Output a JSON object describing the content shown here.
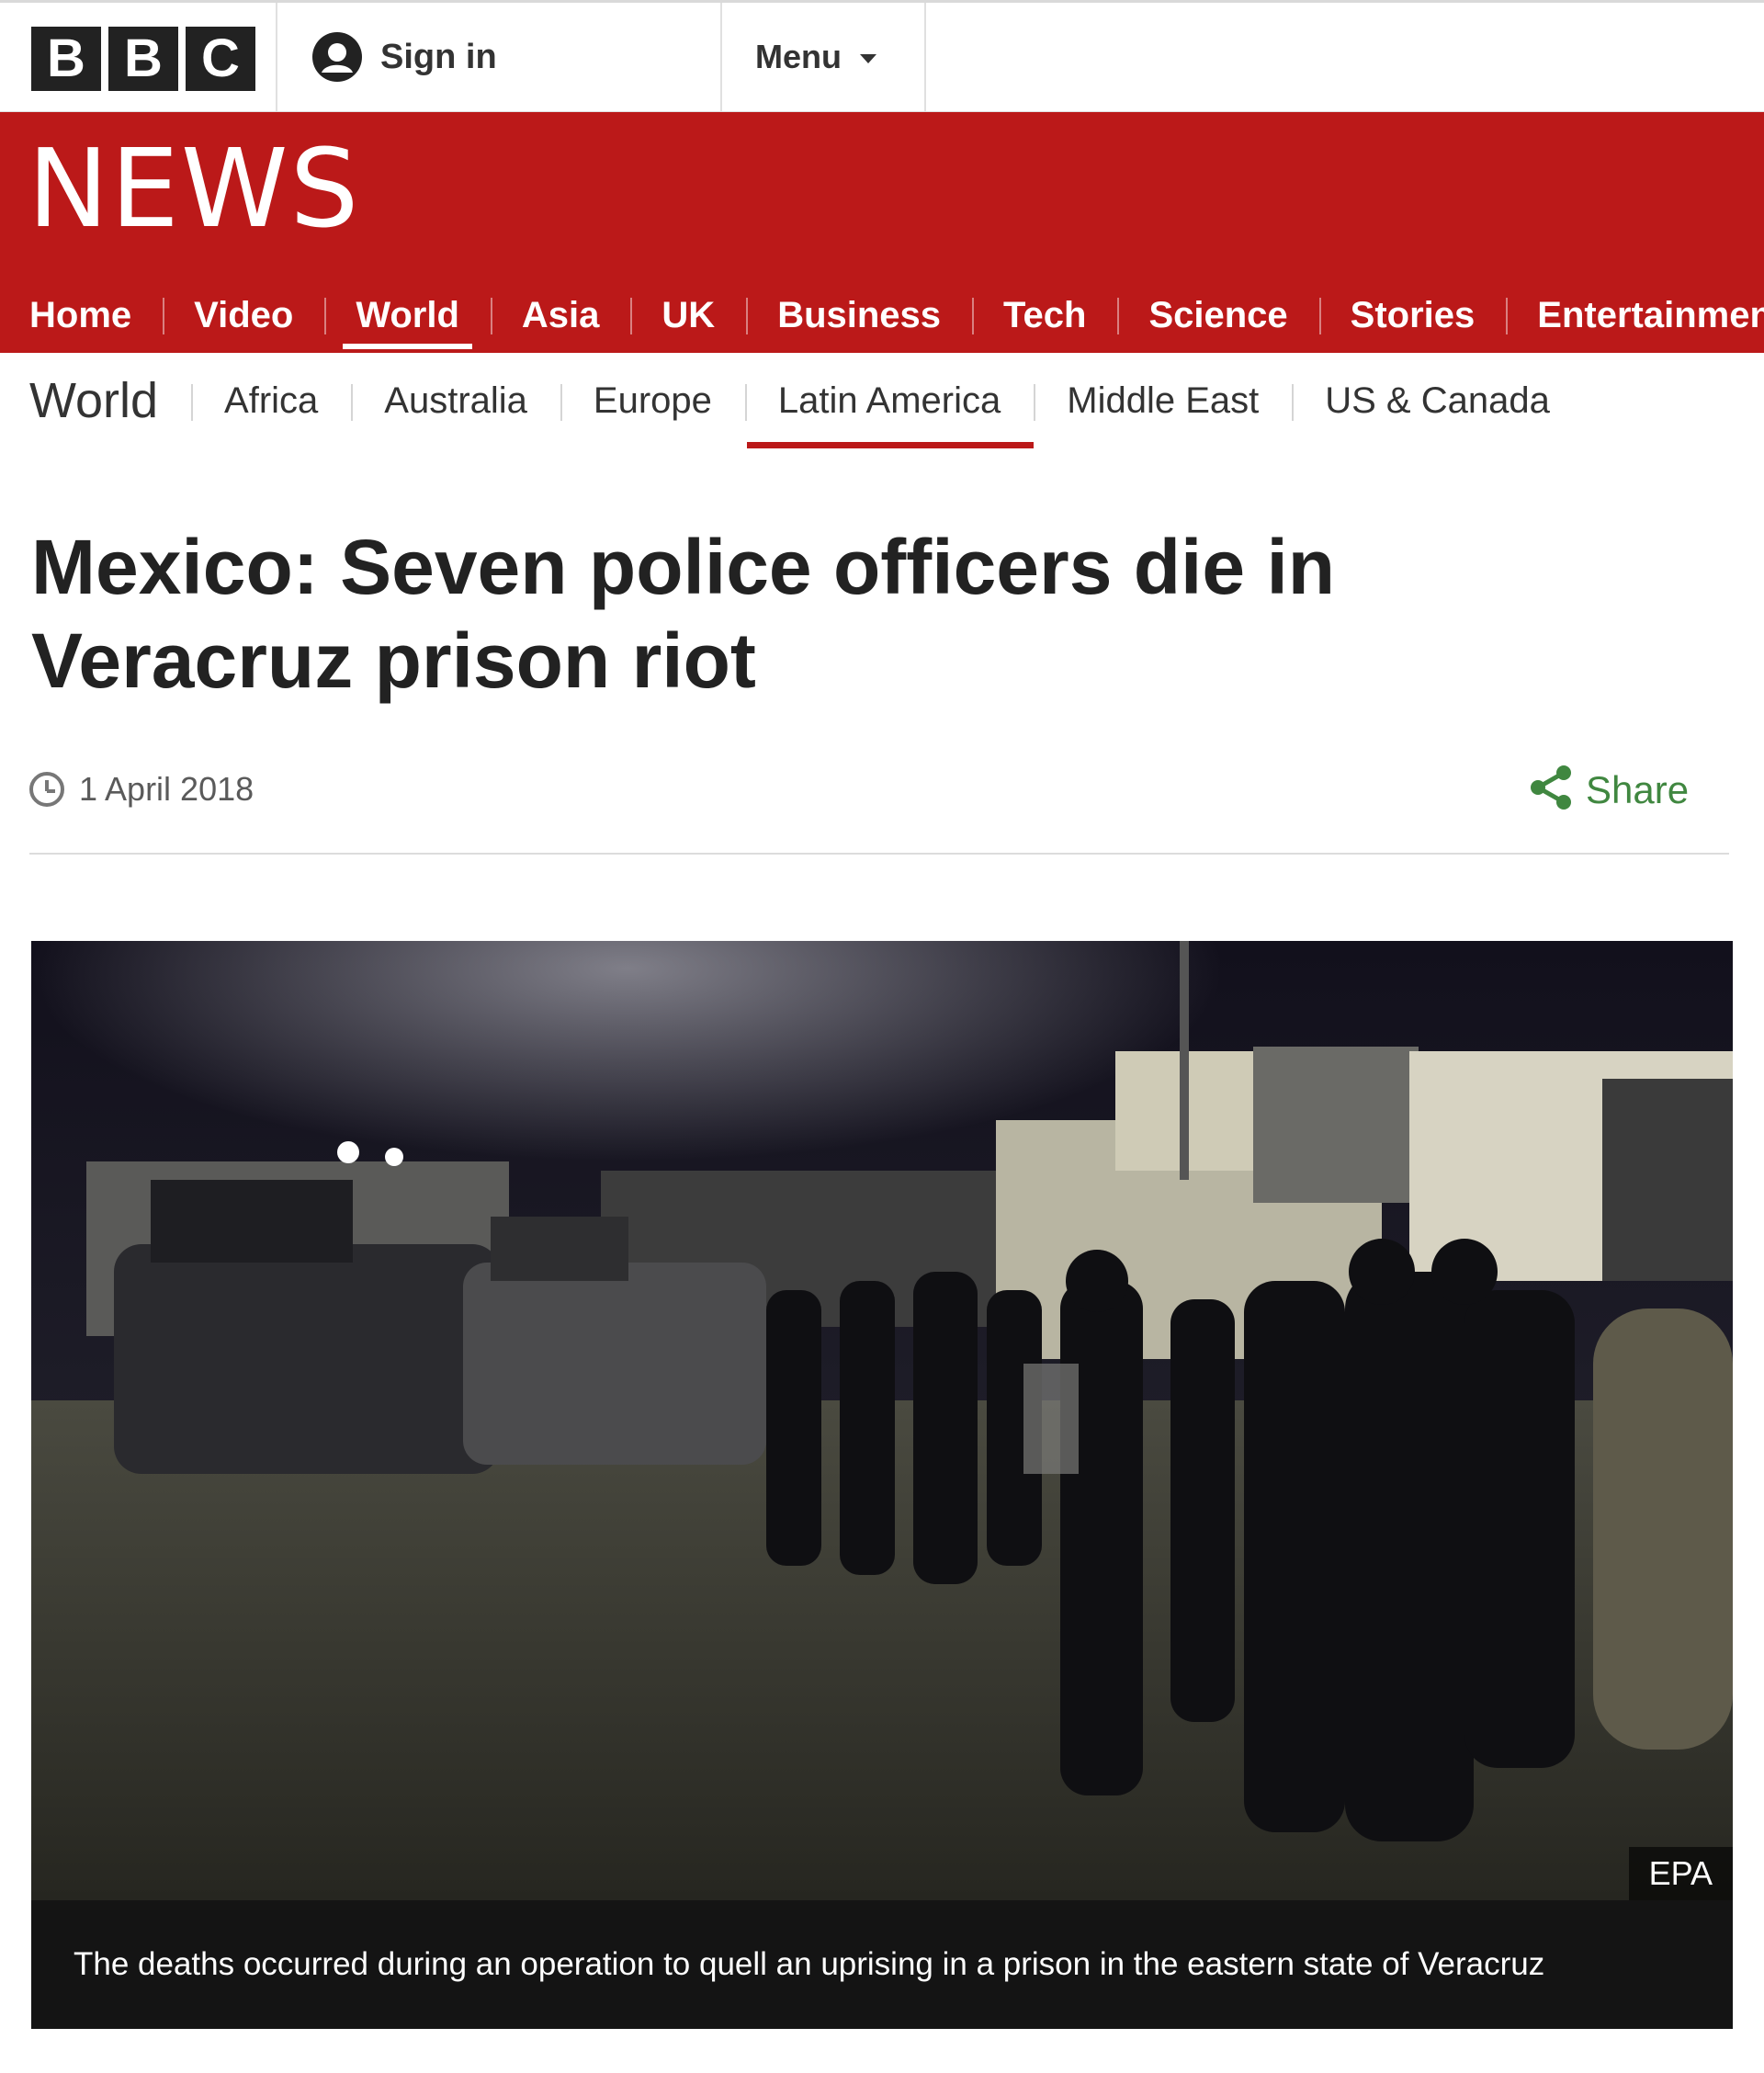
{
  "brand": {
    "logo_letters": [
      "B",
      "B",
      "C"
    ],
    "logo_icon": "bbc-logo"
  },
  "header": {
    "signin_label": "Sign in",
    "signin_icon": "user-icon",
    "menu_label": "Menu",
    "menu_icon": "chevron-down-icon"
  },
  "section_title": "NEWS",
  "main_nav": {
    "items": [
      {
        "label": "Home"
      },
      {
        "label": "Video"
      },
      {
        "label": "World"
      },
      {
        "label": "Asia"
      },
      {
        "label": "UK"
      },
      {
        "label": "Business"
      },
      {
        "label": "Tech"
      },
      {
        "label": "Science"
      },
      {
        "label": "Stories"
      },
      {
        "label": "Entertainment &"
      }
    ],
    "active": "World"
  },
  "sub_nav": {
    "title": "World",
    "items": [
      {
        "label": "Africa"
      },
      {
        "label": "Australia"
      },
      {
        "label": "Europe"
      },
      {
        "label": "Latin America"
      },
      {
        "label": "Middle East"
      },
      {
        "label": "US & Canada"
      }
    ],
    "active": "Latin America"
  },
  "article": {
    "headline": "Mexico: Seven police officers die in Veracruz prison riot",
    "date": "1 April 2018",
    "date_icon": "clock-icon",
    "share_label": "Share",
    "share_icon": "share-icon",
    "image_credit": "EPA",
    "image_caption": "The deaths occurred during an operation to quell an uprising in a prison in the eastern state of Veracruz"
  },
  "colors": {
    "brand_red": "#bb1919",
    "share_green": "#408740",
    "text_dark": "#222222"
  }
}
